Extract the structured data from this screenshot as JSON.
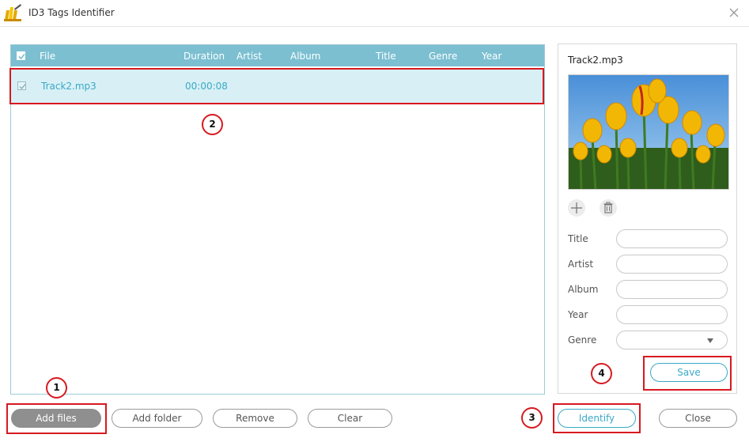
{
  "window": {
    "title": "ID3 Tags Identifier"
  },
  "table": {
    "columns": [
      "File",
      "Duration",
      "Artist",
      "Album",
      "Title",
      "Genre",
      "Year"
    ],
    "rows": [
      {
        "file": "Track2.mp3",
        "duration": "00:00:08",
        "artist": "",
        "album": "",
        "title": "",
        "genre": "",
        "year": ""
      }
    ]
  },
  "details": {
    "file_name": "Track2.mp3",
    "cover_icons": [
      "plus-icon",
      "trash-icon"
    ],
    "fields": {
      "title_label": "Title",
      "artist_label": "Artist",
      "album_label": "Album",
      "year_label": "Year",
      "genre_label": "Genre"
    },
    "save_label": "Save"
  },
  "toolbar": {
    "add_files": "Add files",
    "add_folder": "Add folder",
    "remove": "Remove",
    "clear": "Clear",
    "identify": "Identify",
    "close": "Close"
  },
  "annotations": [
    "1",
    "2",
    "3",
    "4"
  ],
  "colors": {
    "header": "#7bbfd1",
    "selected_row": "#d8f0f5",
    "accent": "#3aa9c5",
    "annotation": "#d71920"
  }
}
